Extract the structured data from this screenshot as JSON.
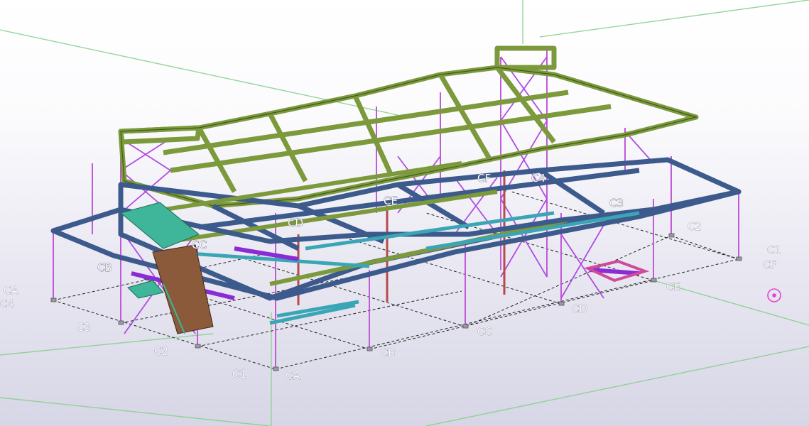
{
  "viewport": {
    "colors": {
      "beam_green": "#7c9a3c",
      "beam_green_dark": "#3f5a1e",
      "beam_blue": "#3d5a8c",
      "beam_blue_dark": "#1f2f55",
      "beam_cyan": "#3aa6b5",
      "bracing_purple": "#b04ce0",
      "column_magenta": "#c05ad8",
      "column_red": "#b94a4a",
      "stair_teal": "#3fb59a",
      "stair_brown": "#8a5a3a",
      "grid_line": "#222222",
      "view_line_green": "#86c48b"
    },
    "grid_labels": {
      "front_left": [
        "CA",
        "C4",
        "C3",
        "C2",
        "C1"
      ],
      "front_bottom": [
        "CA",
        "CB",
        "CC",
        "CD",
        "CE"
      ],
      "right_side": [
        "C2",
        "C1",
        "CF"
      ],
      "in_model": [
        "CB",
        "CC",
        "CD",
        "CE",
        "CF",
        "C4",
        "C3"
      ]
    }
  }
}
